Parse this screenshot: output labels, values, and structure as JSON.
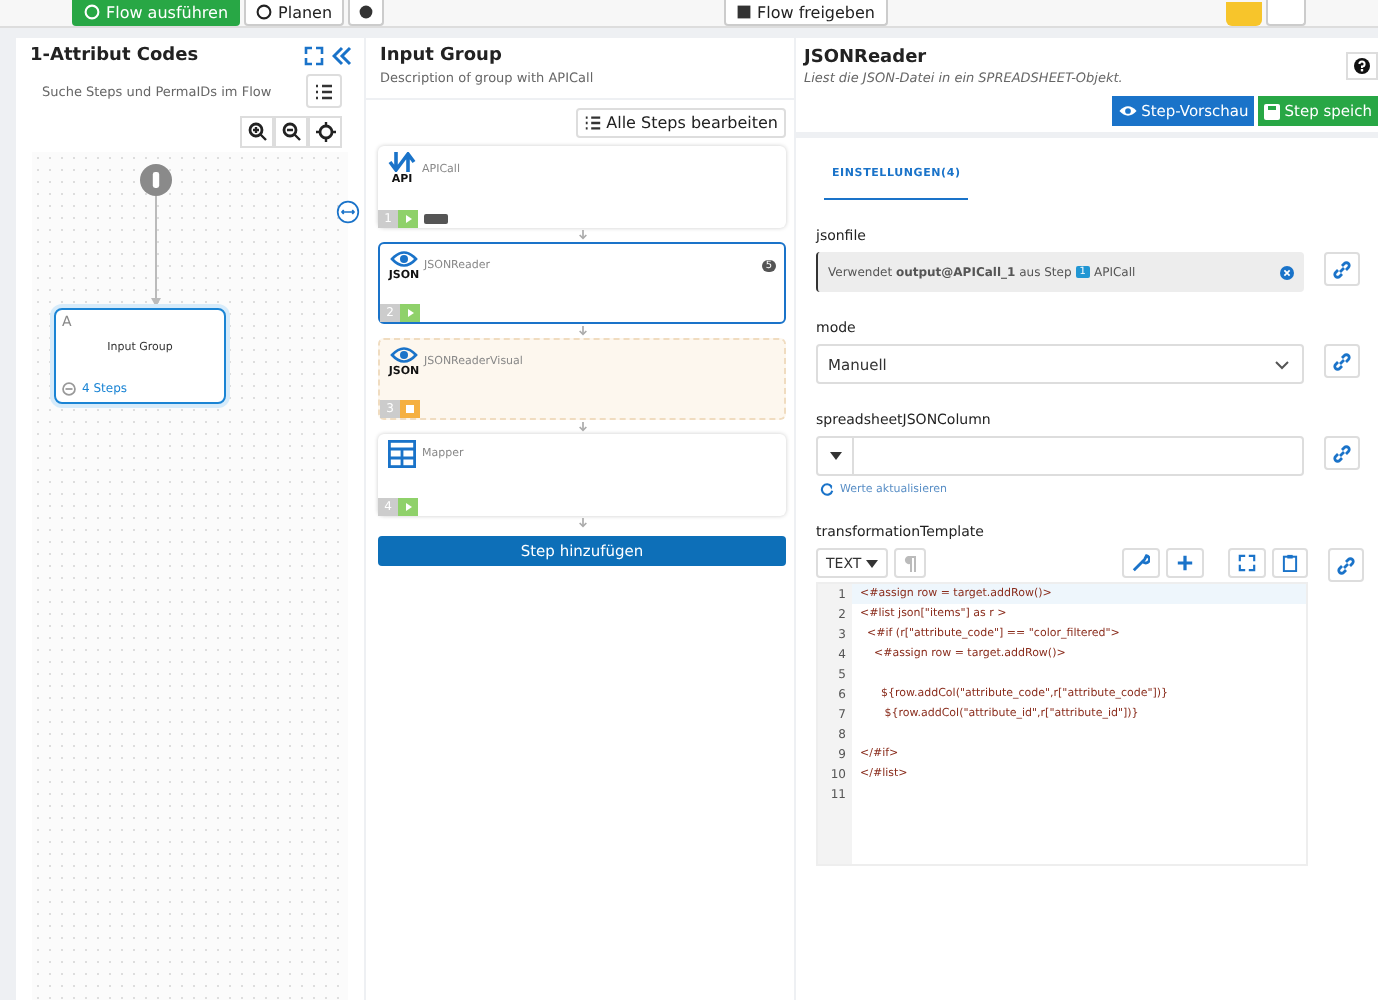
{
  "toolbar": {
    "buttons": [
      {
        "label": "Flow ausführen",
        "kind": "primary"
      },
      {
        "label": "Planen",
        "kind": "plain"
      }
    ],
    "center_button": "Flow freigeben"
  },
  "flow_panel": {
    "title": "Attribut Codes",
    "title_prefix": "1-",
    "search": {
      "placeholder": "Suche Steps und PermaIDs im Flow"
    },
    "node": {
      "letter": "A",
      "title": "Input Group",
      "steps": "4 Steps",
      "selected": true
    }
  },
  "group_panel": {
    "title": "Input Group",
    "description": "Description of group with APICall",
    "edit_button": "Alle Steps bearbeiten",
    "steps": [
      {
        "name": "APICall",
        "number": "1",
        "kind": "api",
        "icon_label": "API",
        "paused": false,
        "selected": false,
        "tag": true
      },
      {
        "name": "JSONReader",
        "number": "2",
        "kind": "json",
        "icon_label": "JSON",
        "paused": false,
        "selected": true,
        "tag": false,
        "count": "5"
      },
      {
        "name": "JSONReaderVisual",
        "number": "3",
        "kind": "json",
        "icon_label": "JSON",
        "paused": true,
        "selected": false,
        "tag": false
      },
      {
        "name": "Mapper",
        "number": "4",
        "kind": "table",
        "paused": false,
        "selected": false,
        "tag": false
      }
    ],
    "add_button": "Step hinzufügen"
  },
  "step_panel": {
    "title": "JSONReader",
    "description": "Liest die JSON-Datei in ein SPREADSHEET-Objekt.",
    "preview_button": "Step-Vorschau",
    "save_button": "Step speich",
    "tabs": [
      {
        "label": "EINSTELLUNGEN(4)",
        "selected": true
      }
    ],
    "fields": [
      {
        "kind": "reference",
        "label": "jsonfile",
        "text": "Verwendet **output@APICall_1** aus Step",
        "step_number": "1",
        "step_name": "APICall"
      },
      {
        "kind": "select",
        "label": "mode",
        "value": "Manuell"
      },
      {
        "kind": "combo",
        "label": "spreadsheetJSONColumn",
        "link": "Werte aktualisieren"
      },
      {
        "kind": "code",
        "label": "transformationTemplate",
        "mode": "TEXT",
        "lines": [
          {
            "number": "1",
            "code": "<#assign row = target.addRow()>"
          },
          {
            "number": "2",
            "code": "<#list json[\"items\"] as r >"
          },
          {
            "number": "3",
            "code": "  <#if (r[\"attribute_code\"] == \"color_filtered\">"
          },
          {
            "number": "4",
            "code": "    <#assign row = target.addRow()>"
          },
          {
            "number": "5"
          },
          {
            "number": "6",
            "code": "      ${row.addCol(\"attribute_code\",r[\"attribute_code\"])}"
          },
          {
            "number": "7",
            "code": "       ${row.addCol(\"attribute_id\",r[\"attribute_id\"])}"
          },
          {
            "number": "8"
          },
          {
            "number": "9",
            "code": "</#if>"
          },
          {
            "number": "10",
            "code": "</#list>"
          },
          {
            "number": "11"
          }
        ]
      }
    ]
  }
}
